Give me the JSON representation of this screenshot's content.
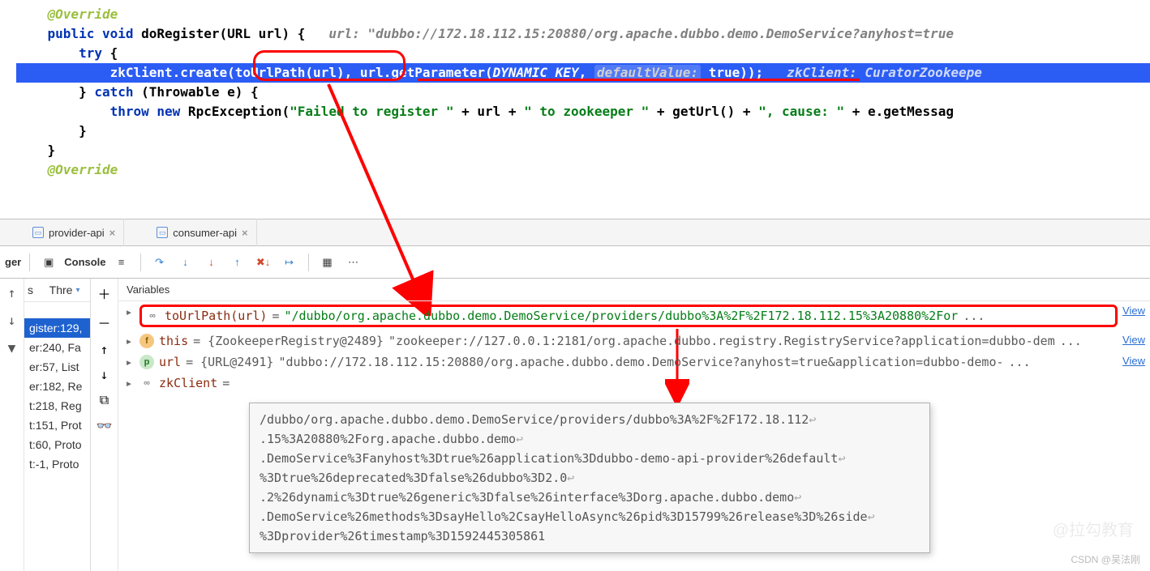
{
  "code": {
    "l1": "@Override",
    "l2a": "public",
    "l2b": "void",
    "l2c": "doRegister(URL url) {   ",
    "l2d": "url: \"dubbo://172.18.112.15:20880/org.apache.dubbo.demo.DemoService?anyhost=true",
    "l3a": "try",
    "l3b": " {",
    "l4_pre": "            ",
    "l4a": "zkClient",
    "l4b": ".create(",
    "l4c": "toUrlPath(url)",
    "l4d": ", url.getParameter(",
    "l4e": "DYNAMIC_KEY",
    "l4f": ", ",
    "l4g": "defaultValue:",
    "l4h": " true",
    "l4i": "));   ",
    "l4j": "zkClient: CuratorZookeepe",
    "l5a": "} ",
    "l5b": "catch",
    "l5c": " (Throwable e) {",
    "l6a": "throw",
    "l6b": " new",
    "l6c": " RpcException(",
    "l6d": "\"Failed to register \"",
    "l6e": " + url + ",
    "l6f": "\" to zookeeper \"",
    "l6g": " + getUrl() + ",
    "l6h": "\", cause: \"",
    "l6i": " + e.getMessag",
    "l7": "        }",
    "l8": "    }",
    "l9": "",
    "l10": "@Override"
  },
  "tabs": {
    "t1": "provider-api",
    "t2": "consumer-api"
  },
  "toolbar": {
    "ger": "ger",
    "console": "Console",
    "thr": "Thre"
  },
  "frames": {
    "hdr": "s",
    "f1": "gister:129,",
    "f2": "er:240, Fa",
    "f3": "er:57, List",
    "f4": "er:182, Re",
    "f5": "t:218, Reg",
    "f6": "t:151, Prot",
    "f7": "t:60, Proto",
    "f8": "t:-1, Proto"
  },
  "vars": {
    "hdr": "Variables",
    "r1n": "toUrlPath(url)",
    "r1eq": " = ",
    "r1v": "\"/dubbo/org.apache.dubbo.demo.DemoService/providers/dubbo%3A%2F%2F172.18.112.15%3A20880%2For",
    "r1e": "...",
    "r2n": "this",
    "r2eq": " = {ZookeeperRegistry@2489} ",
    "r2v": "\"zookeeper://127.0.0.1:2181/org.apache.dubbo.registry.RegistryService?application=dubbo-dem",
    "r2e": "...",
    "r3n": "url",
    "r3eq": " = {URL@2491} ",
    "r3v": "\"dubbo://172.18.112.15:20880/org.apache.dubbo.demo.DemoService?anyhost=true&application=dubbo-demo-",
    "r3e": "...",
    "r4n": "zkClient",
    "r4eq": " = ",
    "view": "View"
  },
  "tooltip": {
    "t1": "/dubbo/org.apache.dubbo.demo.DemoService/providers/dubbo%3A%2F%2F172.18.112",
    "t2": ".15%3A20880%2Forg.apache.dubbo.demo",
    "t3": ".DemoService%3Fanyhost%3Dtrue%26application%3Ddubbo-demo-api-provider%26default",
    "t4": "%3Dtrue%26deprecated%3Dfalse%26dubbo%3D2.0",
    "t5": ".2%26dynamic%3Dtrue%26generic%3Dfalse%26interface%3Dorg.apache.dubbo.demo",
    "t6": ".DemoService%26methods%3DsayHello%2CsayHelloAsync%26pid%3D15799%26release%3D%26side",
    "t7": "%3Dprovider%26timestamp%3D1592445305861"
  },
  "wm": "@拉勾教育",
  "csdn": "CSDN @吴法刚"
}
